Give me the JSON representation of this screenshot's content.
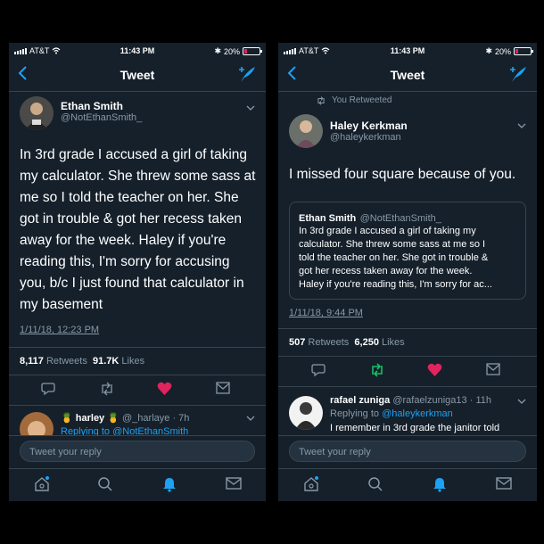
{
  "left": {
    "status": {
      "carrier": "AT&T",
      "time": "11:43 PM",
      "battery": "20%"
    },
    "nav_title": "Tweet",
    "author": {
      "name": "Ethan Smith",
      "handle": "@NotEthanSmith_"
    },
    "tweet_lines": [
      "In 3rd grade I accused a girl of taking",
      "my calculator.  She threw some sass at",
      "me so I told the teacher on her. She",
      "got in trouble & got her recess taken",
      "away for the week. Haley if you're",
      "reading this, I'm sorry for accusing",
      "you, b/c I just found that calculator in",
      "my basement"
    ],
    "date": "1/11/18, 12:23 PM",
    "retweets_count": "8,117",
    "retweets_label": "Retweets",
    "likes_count": "91.7K",
    "likes_label": "Likes",
    "reply": {
      "name": "harley",
      "handle": "@_harlaye",
      "time": "· 7h",
      "partial": "Replying to @NotEthanSmith"
    },
    "reply_placeholder": "Tweet your reply"
  },
  "right": {
    "status": {
      "carrier": "AT&T",
      "time": "11:43 PM",
      "battery": "20%"
    },
    "nav_title": "Tweet",
    "retweeted_label": "You Retweeted",
    "author": {
      "name": "Haley Kerkman",
      "handle": "@haleykerkman"
    },
    "tweet_text": "I missed four square because of you.",
    "quote": {
      "name": "Ethan Smith",
      "handle": "@NotEthanSmith_",
      "lines": [
        "In 3rd grade I accused a girl of taking my",
        "calculator.  She threw some sass at me so I",
        "told the teacher on her. She got in trouble &",
        "got her recess taken away for the week.",
        "Haley if you're reading this, I'm sorry for ac..."
      ]
    },
    "date": "1/11/18, 9:44 PM",
    "retweets_count": "507",
    "retweets_label": "Retweets",
    "likes_count": "6,250",
    "likes_label": "Likes",
    "reply": {
      "name": "rafael zuniga",
      "handle": "@rafaelzuniga13",
      "time": "· 11h",
      "replying_prefix": "Replying to",
      "replying_to": "@haleykerkman",
      "partial": "I remember in 3rd grade the janitor told"
    },
    "reply_placeholder": "Tweet your reply"
  },
  "colors": {
    "background": "#15202b",
    "accent": "#1da1f2",
    "like": "#e0245e",
    "retweet": "#17bf63",
    "muted": "#8899a6",
    "divider": "#38444d"
  },
  "icons": [
    "back-chevron-icon",
    "compose-feather-icon",
    "chevron-down-icon",
    "reply-icon",
    "retweet-icon",
    "like-heart-icon",
    "direct-message-icon",
    "home-icon",
    "search-icon",
    "notifications-bell-icon",
    "messages-icon",
    "wifi-icon",
    "bluetooth-icon",
    "battery-icon"
  ]
}
